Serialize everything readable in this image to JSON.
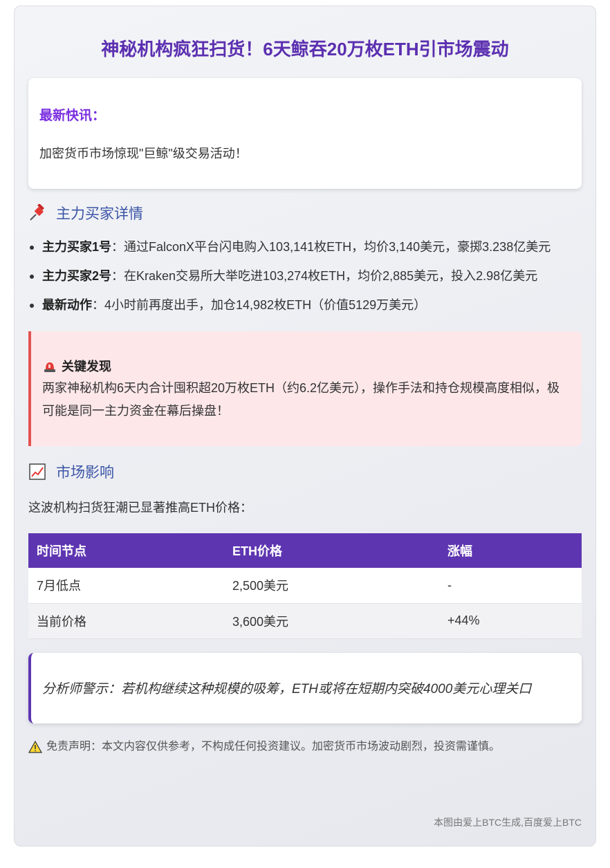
{
  "title": "神秘机构疯狂扫货！6天鲸吞20万枚ETH引市场震动",
  "news": {
    "heading": "最新快讯：",
    "text": "加密货币市场惊现\"巨鲸\"级交易活动！"
  },
  "buyers_section": {
    "icon": "pushpin-icon",
    "heading": "主力买家详情",
    "items": [
      {
        "label": "主力买家1号",
        "text": "：通过FalconX平台闪电购入103,141枚ETH，均价3,140美元，豪掷3.238亿美元"
      },
      {
        "label": "主力买家2号",
        "text": "：在Kraken交易所大举吃进103,274枚ETH，均价2,885美元，投入2.98亿美元"
      },
      {
        "label": "最新动作",
        "text": "：4小时前再度出手，加仓14,982枚ETH（价值5129万美元）"
      }
    ]
  },
  "alert": {
    "icon": "siren-icon",
    "heading": "关键发现",
    "text": "两家神秘机构6天内合计囤积超20万枚ETH（约6.2亿美元），操作手法和持仓规模高度相似，极可能是同一主力资金在幕后操盘！",
    "accent": "#e35252"
  },
  "market_section": {
    "icon": "chart-increasing-icon",
    "heading": "市场影响",
    "intro": "这波机构扫货狂潮已显著推高ETH价格："
  },
  "table": {
    "headers": [
      "时间节点",
      "ETH价格",
      "涨幅"
    ],
    "rows": [
      [
        "7月低点",
        "2,500美元",
        "-"
      ],
      [
        "当前价格",
        "3,600美元",
        "+44%"
      ]
    ],
    "header_color": "#5e35b1"
  },
  "quote": "分析师警示：若机构继续这种规模的吸筹，ETH或将在短期内突破4000美元心理关口",
  "disclaimer": {
    "icon": "warning-icon",
    "text": "免责声明：本文内容仅供参考，不构成任何投资建议。加密货币市场波动剧烈，投资需谨慎。"
  },
  "footer": "本图由爱上BTC生成,百度爱上BTC"
}
